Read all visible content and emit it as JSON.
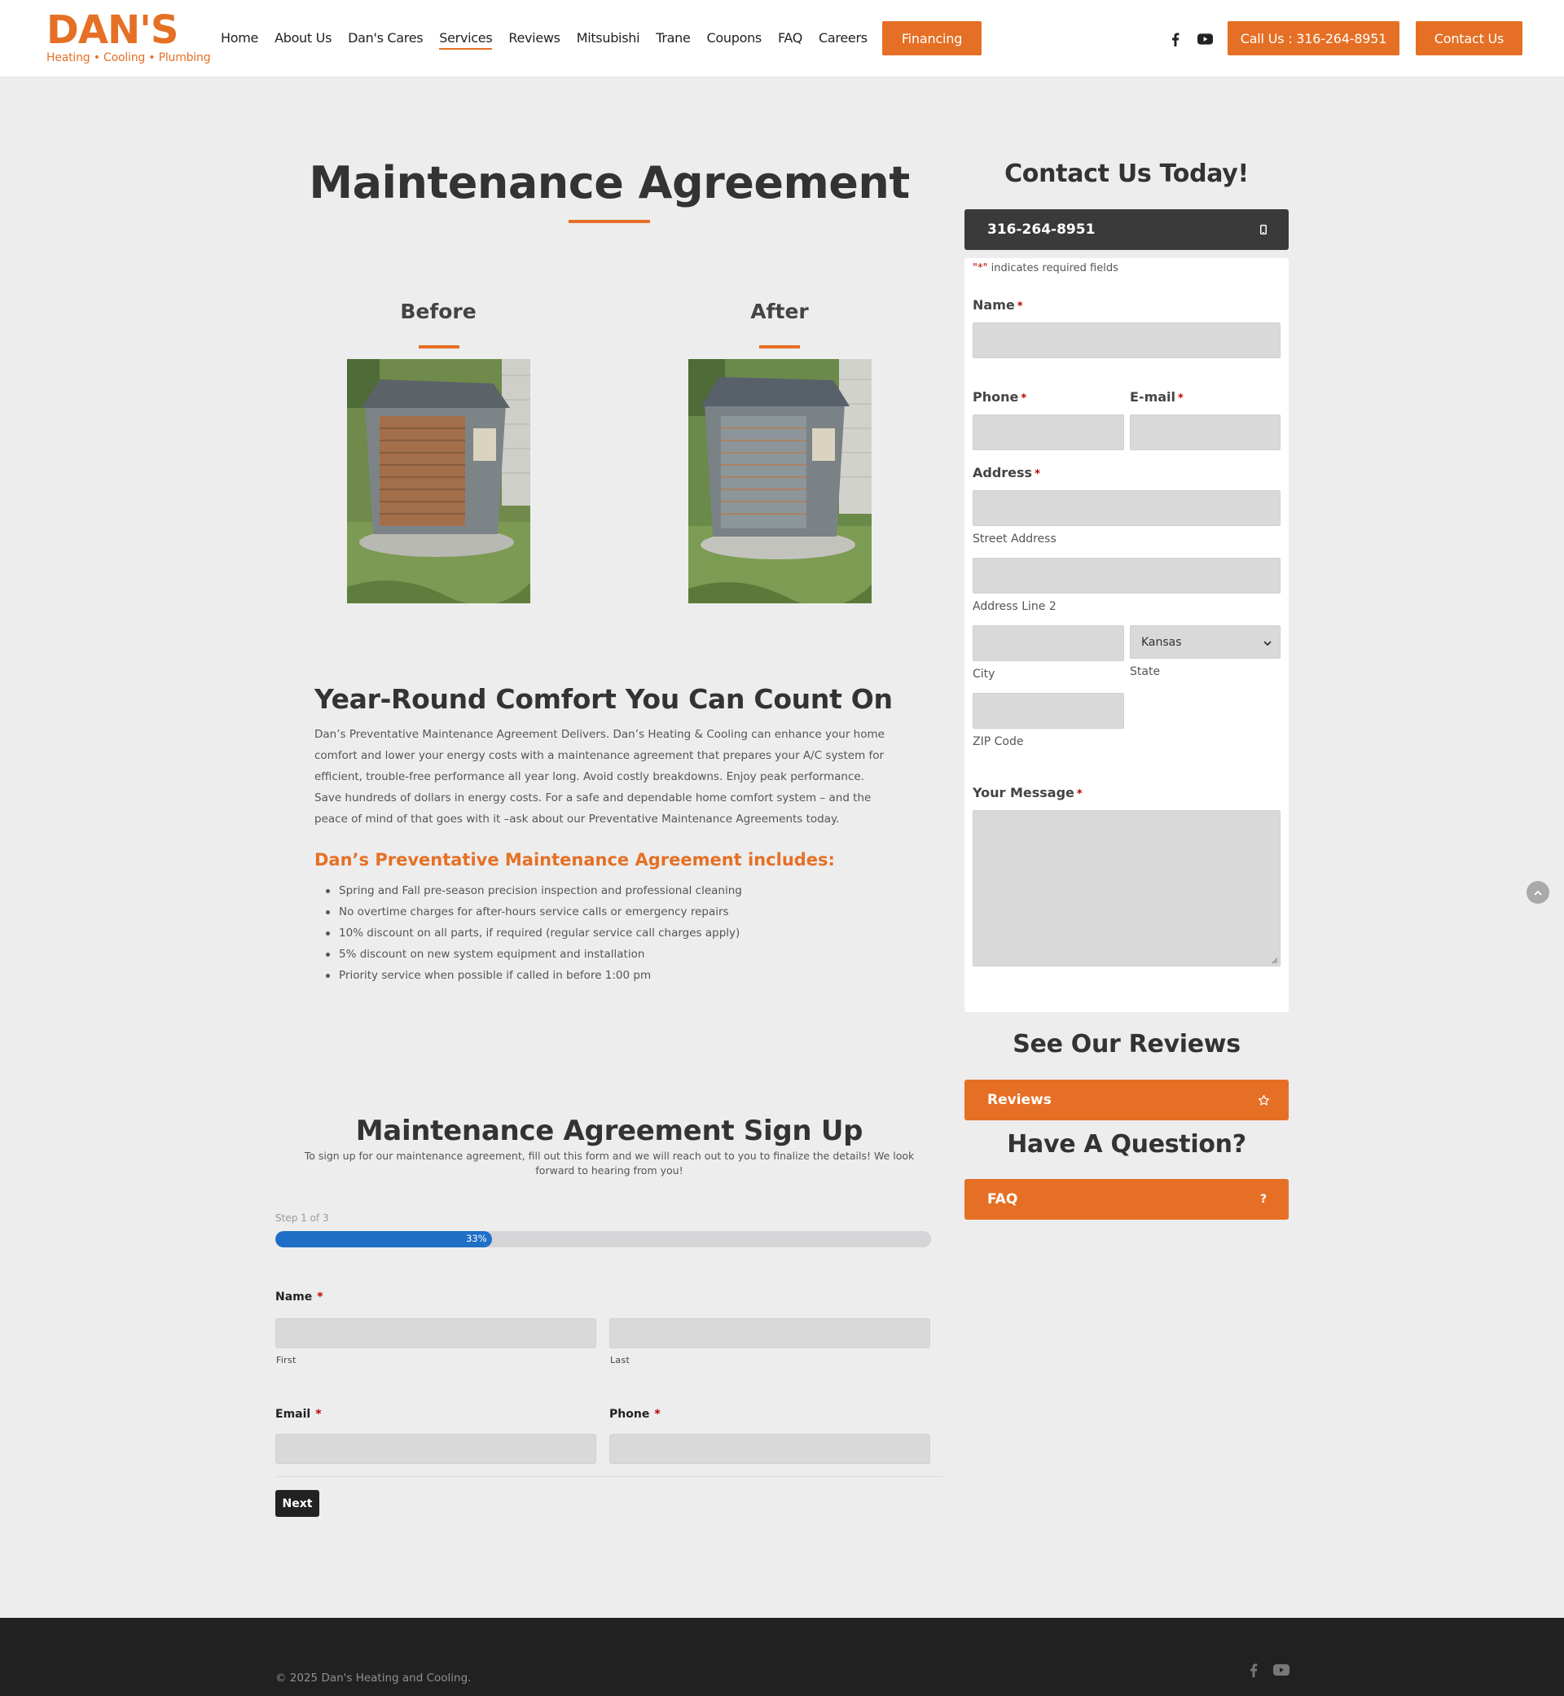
{
  "brand": {
    "logo_main": "DAN'S",
    "logo_sub": "Heating • Cooling • Plumbing",
    "accent_color": "#e57025",
    "dark_color": "#3a3a3a"
  },
  "nav": {
    "items": [
      {
        "label": "Home"
      },
      {
        "label": "About Us"
      },
      {
        "label": "Dan's Cares"
      },
      {
        "label": "Services",
        "active": true
      },
      {
        "label": "Reviews"
      },
      {
        "label": "Mitsubishi"
      },
      {
        "label": "Trane"
      },
      {
        "label": "Coupons"
      },
      {
        "label": "FAQ"
      },
      {
        "label": "Careers"
      }
    ],
    "financing_label": "Financing",
    "call_label": "Call Us : 316-264-8951",
    "contact_label": "Contact Us",
    "social_icons": [
      "facebook-icon",
      "youtube-icon"
    ]
  },
  "main": {
    "title": "Maintenance Agreement",
    "before_label": "Before",
    "after_label": "After",
    "heading": "Year-Round Comfort You Can Count On",
    "paragraph": "Dan’s Preventative Maintenance Agreement Delivers. Dan’s Heating & Cooling can enhance your home comfort and lower your energy costs with a maintenance agreement that prepares your A/C system for efficient, trouble-free performance all year long. Avoid costly breakdowns. Enjoy peak performance. Save hundreds of dollars in energy costs. For a safe and dependable home comfort system – and the peace of mind of that goes with it –ask about our Preventative Maintenance Agreements today.",
    "includes_heading": "Dan’s Preventative Maintenance Agreement includes:",
    "includes": [
      "Spring and Fall pre-season precision inspection and professional cleaning",
      "No overtime charges for after-hours service calls or emergency repairs",
      "10% discount on all parts, if required (regular service call charges apply)",
      "5% discount on new system equipment and installation",
      "Priority service when possible if called in before 1:00 pm"
    ]
  },
  "signup": {
    "title": "Maintenance Agreement Sign Up",
    "description": "To sign up for our maintenance agreement, fill out this form and we will reach out to you to finalize the details! We look forward to hearing from you!",
    "step_label": "Step 1 of 3",
    "progress": 33,
    "progress_text": "33%",
    "name_label": "Name",
    "first_sublabel": "First",
    "last_sublabel": "Last",
    "email_label": "Email",
    "phone_label": "Phone",
    "required_mark": "*",
    "next_label": "Next"
  },
  "sidebar": {
    "contact_title": "Contact Us Today!",
    "phone_bar": "316-264-8951",
    "required_note_mark": "\"*\"",
    "required_note": " indicates required fields",
    "name_label": "Name",
    "phone_label": "Phone",
    "email_label": "E-mail",
    "address_label": "Address",
    "street_sublabel": "Street Address",
    "line2_sublabel": "Address Line 2",
    "city_sublabel": "City",
    "state_sublabel": "State",
    "state_value": "Kansas",
    "zip_sublabel": "ZIP Code",
    "message_label": "Your Message",
    "required_mark": "*",
    "reviews_title": "See Our Reviews",
    "reviews_bar": "Reviews",
    "question_title": "Have A Question?",
    "faq_bar": "FAQ",
    "faq_icon_text": "?"
  },
  "footer": {
    "copyright": "© 2025 Dan's Heating and Cooling.",
    "social_icons": [
      "facebook-icon",
      "youtube-icon"
    ]
  }
}
